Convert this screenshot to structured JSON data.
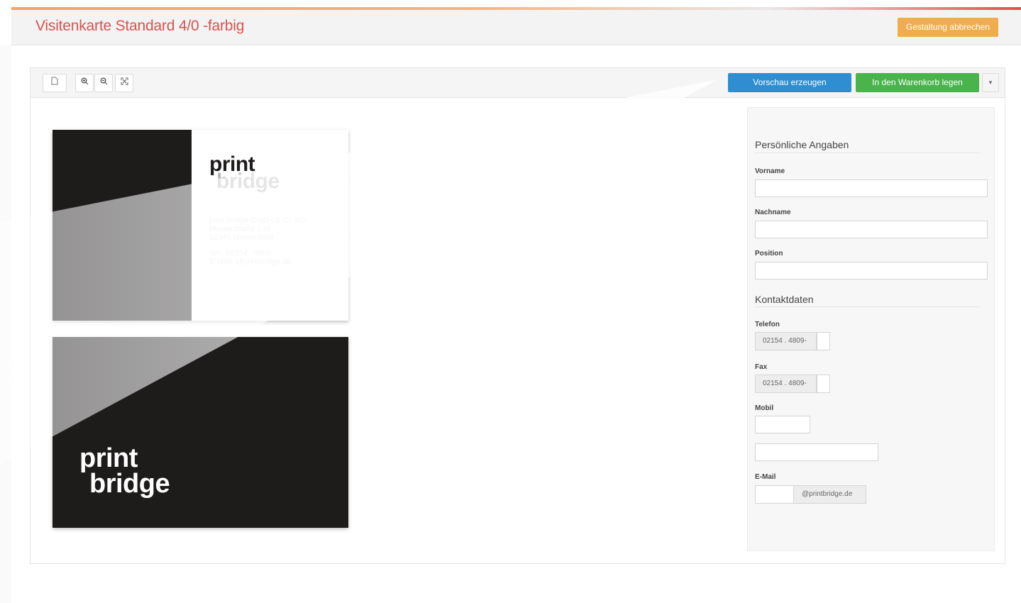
{
  "header": {
    "title": "Visitenkarte Standard 4/0 -farbig",
    "cancel_label": "Gestaltung abbrechen"
  },
  "toolbar": {
    "preview_label": "Vorschau erzeugen",
    "cart_label": "In den Warenkorb legen",
    "tools": [
      "page-icon",
      "zoom-in-icon",
      "zoom-out-icon",
      "fit-icon",
      "dropdown-caret-icon"
    ]
  },
  "card_front": {
    "logo_print": "print",
    "logo_bridge": "bridge",
    "address_line1": "print bridge GmbH & Co KG",
    "address_line2": "Musterstraße 123",
    "address_line3": "12345 Musterstadt",
    "phone_line": "Tel.:     02154 . 4809 -",
    "email_line": "E-Mail:  @printbridge.de"
  },
  "card_back": {
    "logo_print": "print",
    "logo_bridge": "bridge"
  },
  "form": {
    "personal_title": "Persönliche Angaben",
    "vorname_label": "Vorname",
    "nachname_label": "Nachname",
    "position_label": "Position",
    "contact_title": "Kontaktdaten",
    "telefon_label": "Telefon",
    "telefon_prefix": "02154 . 4809-",
    "fax_label": "Fax",
    "fax_prefix": "02154 . 4809-",
    "mobil_label": "Mobil",
    "email_label": "E-Mail",
    "email_suffix": "@printbridge.de"
  },
  "colors": {
    "title_red": "#d9534f",
    "cancel_orange": "#f0ad4e",
    "preview_blue": "#2f8ed1",
    "cart_green": "#48b44b",
    "card_dark": "#1e1b1b"
  }
}
